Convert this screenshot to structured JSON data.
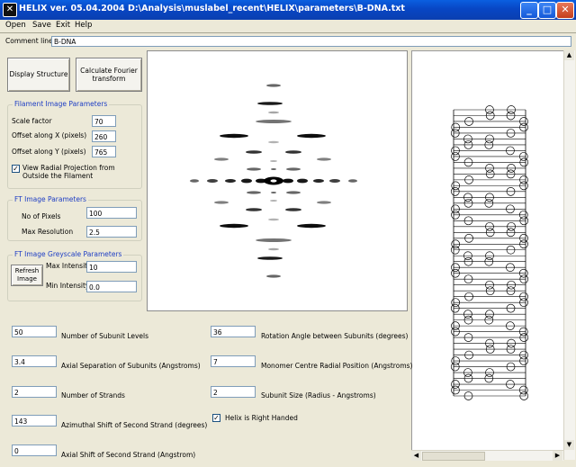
{
  "window": {
    "title": "HELIX ver. 05.04.2004  D:\\Analysis\\muslabel_recent\\HELIX\\parameters\\B-DNA.txt",
    "minimize": "_",
    "maximize": "□",
    "close": "✕"
  },
  "menu": [
    "Open",
    "Save",
    "Exit",
    "Help"
  ],
  "comment": {
    "label": "Comment line:",
    "value": "B-DNA"
  },
  "buttons": {
    "display": "Display Structure",
    "fourier": "Calculate  Fourier transform",
    "refresh": "Refresh Image"
  },
  "filament": {
    "title": "Filament Image Parameters",
    "scale_label": "Scale factor",
    "scale_value": "70",
    "offx_label": "Offset along X (pixels)",
    "offx_value": "260",
    "offy_label": "Offset along Y (pixels)",
    "offy_value": "765",
    "radial_label": "View Radial Projection from Outside the Filament",
    "radial_checked": true
  },
  "ft": {
    "title": "FT Image Parameters",
    "pixels_label": "No of Pixels",
    "pixels_value": "100",
    "res_label": "Max Resolution",
    "res_value": "2.5"
  },
  "greyscale": {
    "title": "FT Image Greyscale Parameters",
    "max_label": "Max Intensity",
    "max_value": "10",
    "min_label": "Min Intensity",
    "min_value": "0.0"
  },
  "params": {
    "levels_value": "50",
    "levels_label": "Number of Subunit Levels",
    "axial_value": "3.4",
    "axial_label": "Axial Separation of Subunits (Angstroms)",
    "strands_value": "2",
    "strands_label": "Number of Strands",
    "azim_value": "143",
    "azim_label": "Azimuthal Shift of Second Strand (degrees)",
    "axshift_value": "0",
    "axshift_label": "Axial Shift of Second Strand (Angstrom)",
    "rot_value": "36",
    "rot_label": "Rotation Angle between Subunits (degrees)",
    "radial_value": "7",
    "radial_label": "Monomer Centre Radial Position (Angstroms)",
    "size_value": "2",
    "size_label": "Subunit Size (Radius - Angstroms)",
    "righthanded_label": "Helix is Right Handed",
    "righthanded_checked": true
  }
}
